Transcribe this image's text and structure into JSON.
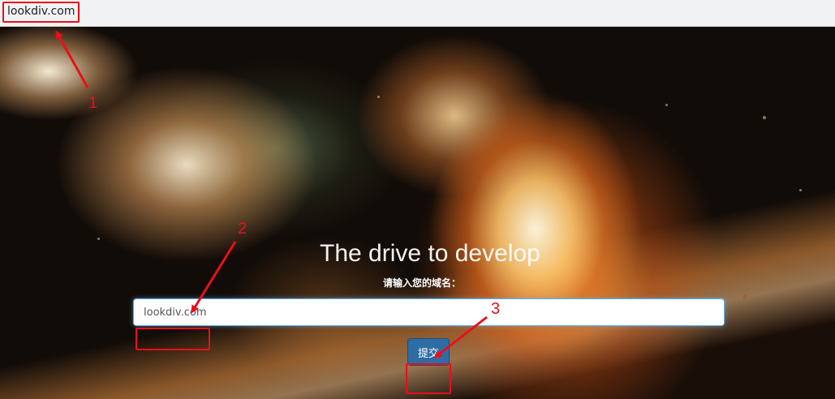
{
  "browser": {
    "address": "lookdiv.com"
  },
  "hero": {
    "headline": "The drive to develop",
    "input_label": "请输入您的域名：",
    "input_placeholder": "lookdiv.com",
    "submit_label": "提交"
  },
  "annotations": {
    "step1": "1",
    "step2": "2",
    "step3": "3",
    "color": "#e8101a"
  },
  "colors": {
    "button_primary": "#2e6da4",
    "input_focus_border": "#66afe9",
    "address_bar_bg": "#f1f2f3"
  }
}
